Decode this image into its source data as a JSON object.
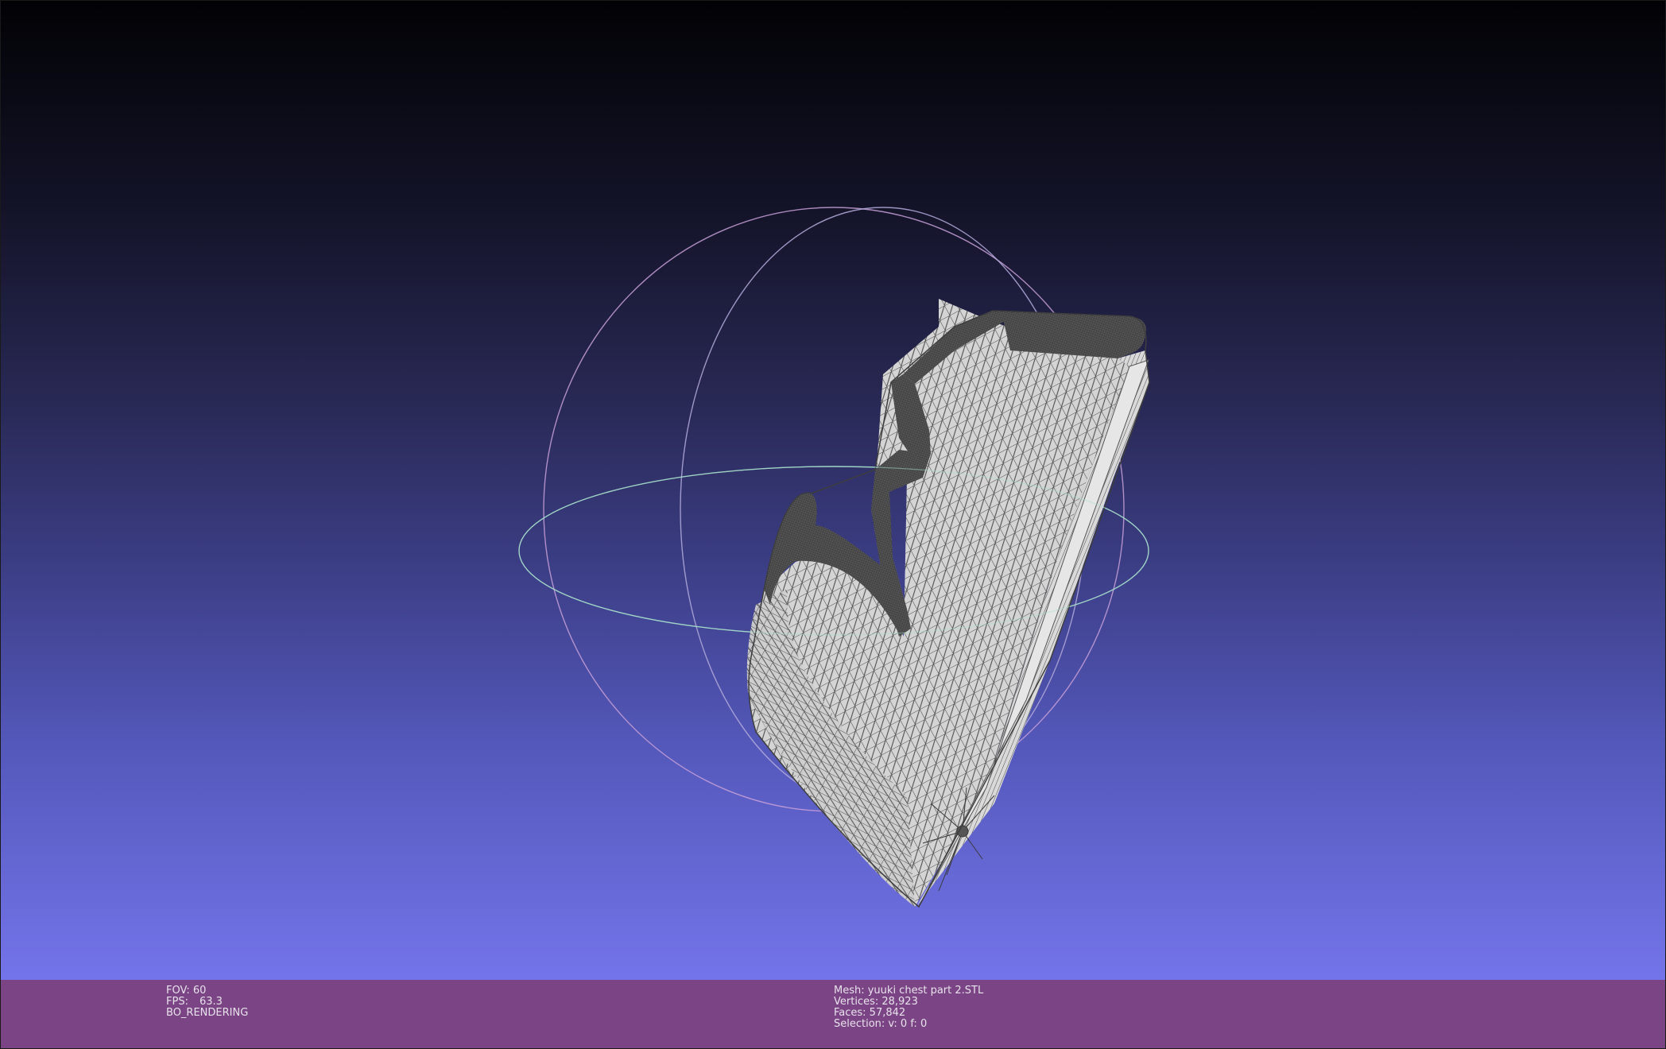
{
  "viewport": {
    "background_top": "#020205",
    "background_bottom": "#7474ea",
    "mesh_fill": "#d7d7d7",
    "wire_color": "#4a4a4a",
    "trackball_colors": {
      "x_ring": "#c8a0d8",
      "y_ring": "#b0a8e0",
      "z_ring": "#a0e0c8"
    }
  },
  "info": {
    "fov": "FOV: 60",
    "fps_label": "FPS:",
    "fps_value": "63.3",
    "render_mode": "BO_RENDERING",
    "mesh": "Mesh: yuuki chest part 2.STL",
    "vertices": "Vertices: 28,923",
    "faces": "Faces: 57,842",
    "selection": "Selection: v: 0 f: 0"
  },
  "info_bar_color": "#7b4585"
}
